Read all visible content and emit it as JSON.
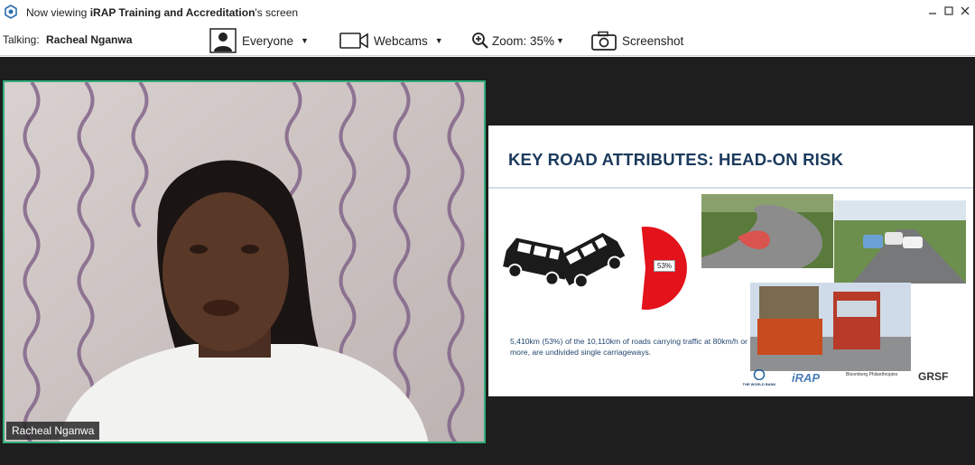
{
  "window": {
    "title_prefix": "Now viewing ",
    "title_owner": "iRAP Training and Accreditation",
    "title_suffix": "'s screen",
    "minimize_icon": "minimize-icon",
    "maximize_icon": "maximize-icon",
    "close_icon": "close-icon"
  },
  "toolbar": {
    "talking_label": "Talking:",
    "talking_name": "Racheal Nganwa",
    "audience_label": "Everyone",
    "webcams_label": "Webcams",
    "zoom_label": "Zoom: 35%",
    "screenshot_label": "Screenshot"
  },
  "webcam": {
    "participant_name": "Racheal Nganwa",
    "accent_color": "#2fae7a"
  },
  "slide": {
    "title": "KEY ROAD ATTRIBUTES:  HEAD-ON RISK",
    "percent_label": "53%",
    "percent_value": 53,
    "caption": "5,410km (53%) of the 10,110km of roads carrying traffic at 80km/h or more, are undivided single carriageways.",
    "logos": [
      "THE WORLD BANK",
      "iRAP",
      "Bloomberg Philanthropies",
      "GRSF"
    ]
  }
}
